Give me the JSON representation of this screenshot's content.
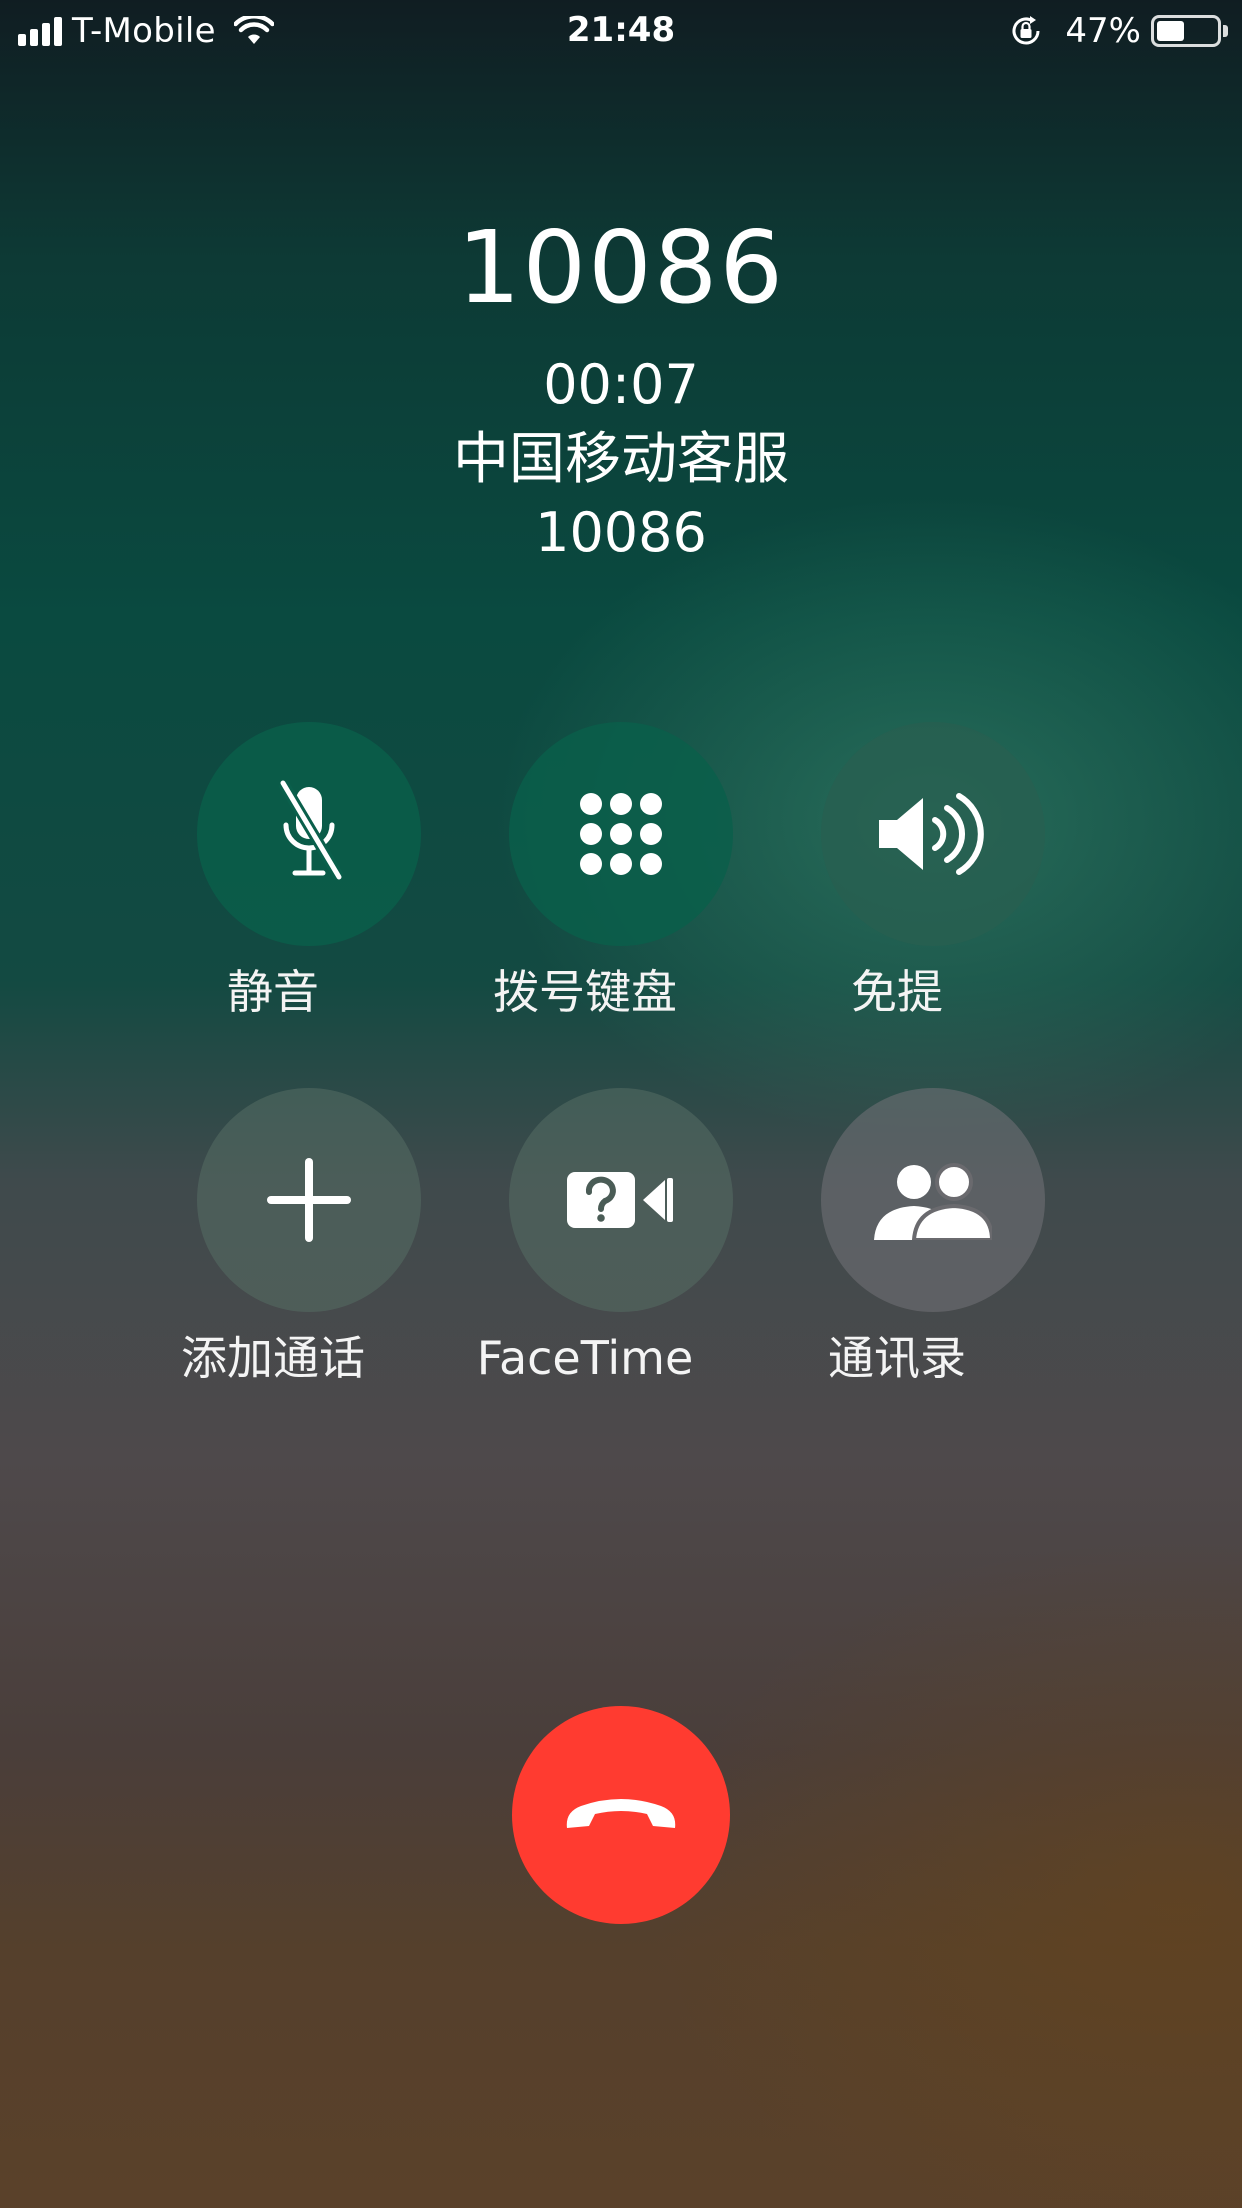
{
  "status_bar": {
    "carrier": "T-Mobile",
    "time": "21:48",
    "battery_percent": "47%",
    "battery_level": 0.47,
    "signal_bars": 4,
    "icons": [
      "signal-bars-icon",
      "wifi-icon",
      "orientation-lock-icon",
      "battery-icon"
    ]
  },
  "call": {
    "number": "10086",
    "duration": "00:07",
    "label": "中国移动客服",
    "sub_label": "10086"
  },
  "controls": [
    {
      "label": "静音",
      "icon": "mute-icon"
    },
    {
      "label": "拨号键盘",
      "icon": "keypad-icon"
    },
    {
      "label": "免提",
      "icon": "speaker-icon"
    },
    {
      "label": "添加通话",
      "icon": "add-call-icon"
    },
    {
      "label": "FaceTime",
      "icon": "facetime-icon"
    },
    {
      "label": "通讯录",
      "icon": "contacts-icon"
    }
  ],
  "end_call": {
    "icon": "end-call-icon",
    "color": "#ff3b30"
  },
  "colors": {
    "text": "#ffffff",
    "end_call": "#ff3b30"
  }
}
